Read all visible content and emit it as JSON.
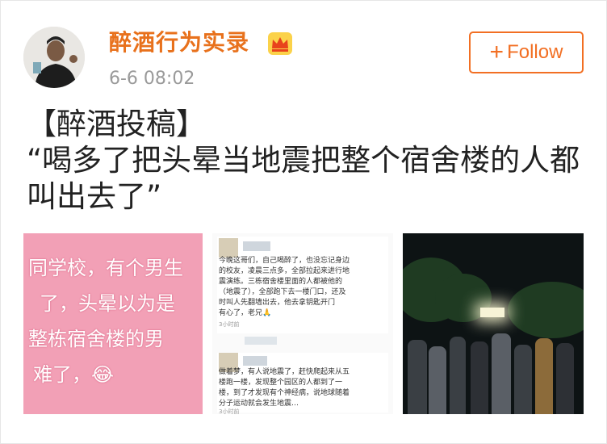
{
  "post": {
    "user_name": "醉酒行为实录",
    "timestamp": "6-6 08:02",
    "follow_label": "Follow",
    "text": "【醉酒投稿】\n“喝多了把头晕当地震把整个宿舍楼的人都叫出去了”"
  },
  "images": {
    "image1_lines": [
      "同学校，有个男生",
      "了，头晕以为是",
      "整栋宿舍楼的男",
      "难了，😂"
    ],
    "image2": {
      "comment1_text": "今晚这哥们，自己喝醉了，也没忘记身边\n的校友，凌晨三点多，全部拉起来进行地\n震演练。三栋宿舍楼里面的人都被他的\n（地震了），全部跑下去一楼门口，还及\n时叫人先翻墙出去，他去拿钥匙开门\n有心了，老兄🙏",
      "comment1_meta": "3小时前",
      "comment2_text": "做着梦，有人说地震了，赶快爬起来从五\n楼跑一楼，发现整个园区的人都到了一\n楼，到了才发现有个神经病，说地球随着\n分子运动就会发生地震…",
      "comment2_meta": "3小时前"
    }
  },
  "colors": {
    "accent": "#e8711c",
    "follow": "#f26f23",
    "timestamp": "#9a9a9a"
  },
  "icons": [
    "crown-vip-icon",
    "plus-icon"
  ]
}
